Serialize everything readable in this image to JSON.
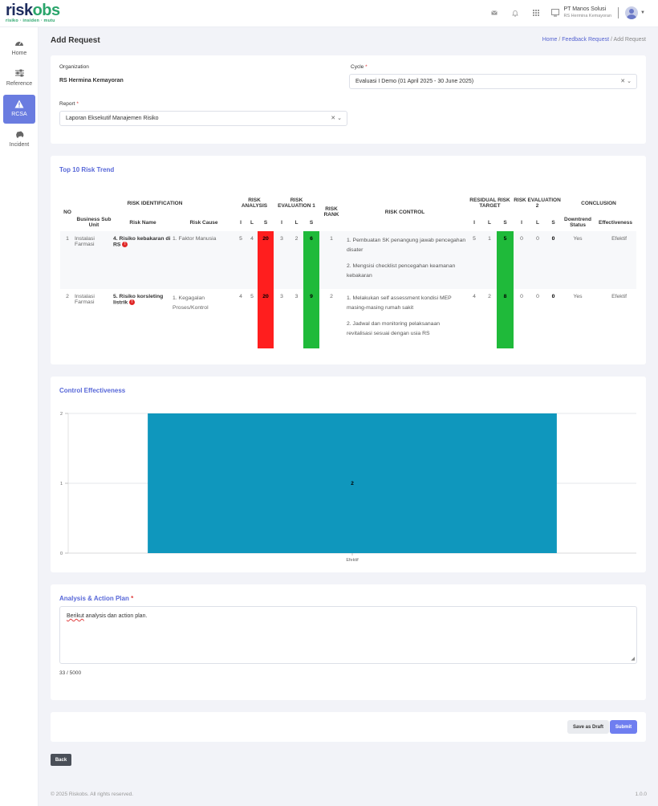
{
  "header": {
    "logo_main_a": "risk",
    "logo_main_b": "obs",
    "logo_tagline": "risiko · insiden · mutu",
    "user_name": "PT Manos Solusi",
    "user_org": "RS Hermina Kemayoran",
    "icons": [
      "mail-icon",
      "bell-icon",
      "grid-icon",
      "screen-icon"
    ]
  },
  "sidebar": {
    "items": [
      {
        "label": "Home",
        "icon": "gauge-icon"
      },
      {
        "label": "Reference",
        "icon": "sliders-icon"
      },
      {
        "label": "RCSA",
        "icon": "warning-icon",
        "active": true
      },
      {
        "label": "Incident",
        "icon": "car-crash-icon"
      }
    ]
  },
  "page": {
    "title": "Add Request",
    "breadcrumb": [
      "Home",
      "Feedback Request",
      "Add Request"
    ]
  },
  "form": {
    "organization_label": "Organization",
    "organization_value": "RS Hermina Kemayoran",
    "cycle_label": "Cycle",
    "cycle_value": "Evaluasi I Demo (01 April 2025 - 30 June 2025)",
    "report_label": "Report",
    "report_value": "Laporan Eksekutif Manajemen Risiko",
    "required_mark": "*"
  },
  "risk_trend": {
    "title": "Top 10 Risk Trend",
    "headers": {
      "no": "NO",
      "risk_identification": "RISK IDENTIFICATION",
      "risk_analysis": "RISK ANALYSIS",
      "risk_evaluation_1": "RISK EVALUATION 1",
      "risk_rank": "RISK RANK",
      "risk_control": "RISK CONTROL",
      "residual_risk_target": "RESIDUAL RISK TARGET",
      "risk_evaluation_2": "RISK EVALUATION 2",
      "conclusion": "CONCLUSION",
      "business_sub_unit": "Business Sub Unit",
      "risk_name": "Risk Name",
      "risk_cause": "Risk Cause",
      "i": "I",
      "l": "L",
      "s": "S",
      "downtrend_status": "Downtrend Status",
      "effectiveness": "Effectiveness"
    },
    "rows": [
      {
        "no": "1",
        "sub_unit": "Instalasi Farmasi",
        "risk_name": "4. Risiko kebakaran di RS",
        "risk_cause": "1. Faktor Manusia",
        "ra_i": "5",
        "ra_l": "4",
        "ra_s": "20",
        "re1_i": "3",
        "re1_l": "2",
        "re1_s": "6",
        "rank": "1",
        "controls": [
          "1. Pembuatan SK penangung jawab pencegahan disater",
          "2. Mengsisi checklist pencegahan keamanan kebakaran"
        ],
        "rt_i": "5",
        "rt_l": "1",
        "rt_s": "5",
        "re2_i": "0",
        "re2_l": "0",
        "re2_s": "0",
        "downtrend": "Yes",
        "effectiveness": "Efektif"
      },
      {
        "no": "2",
        "sub_unit": "Instalasi Farmasi",
        "risk_name": "5. Risiko korsleting listrik",
        "risk_cause": "1. Kegagalan Proses/Kontrol",
        "ra_i": "4",
        "ra_l": "5",
        "ra_s": "20",
        "re1_i": "3",
        "re1_l": "3",
        "re1_s": "9",
        "rank": "2",
        "controls": [
          "1. Melakukan self assessment kondisi MEP masing-masing rumah sakit",
          "2. Jadwal dan monitoring pelaksanaan revitalisasi sesuai dengan usia RS"
        ],
        "rt_i": "4",
        "rt_l": "2",
        "rt_s": "8",
        "re2_i": "0",
        "re2_l": "0",
        "re2_s": "0",
        "downtrend": "Yes",
        "effectiveness": "Efektif"
      }
    ],
    "colors": {
      "high": "#ff1e1e",
      "low": "#1fba3a"
    }
  },
  "control_effectiveness": {
    "title": "Control Effectiveness"
  },
  "chart_data": {
    "type": "bar",
    "categories": [
      "Efektif"
    ],
    "values": [
      2
    ],
    "ylim": [
      0,
      2
    ],
    "yticks": [
      0,
      1,
      2
    ],
    "grid": true,
    "bar_color": "#0f97bd",
    "title": "",
    "xlabel": "",
    "ylabel": ""
  },
  "analysis": {
    "title": "Analysis & Action Plan",
    "text_first": "Berikut",
    "text_rest": " analysis dan action plan.",
    "counter": "33 / 5000"
  },
  "buttons": {
    "save_draft": "Save as Draft",
    "submit": "Submit",
    "back": "Back"
  },
  "footer": {
    "copyright": "© 2025 Riskobs. All rights reserved.",
    "version": "1.0.0"
  }
}
